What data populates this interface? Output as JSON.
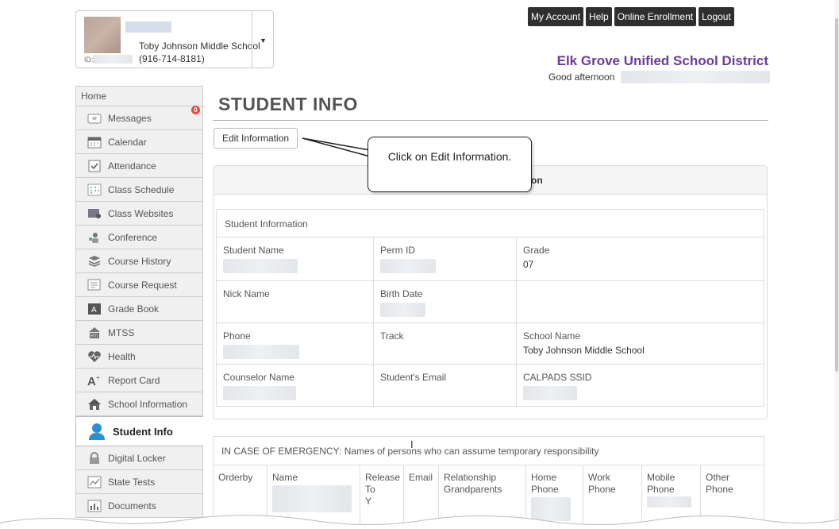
{
  "student": {
    "school": "Toby Johnson Middle School",
    "id_label": "ID:",
    "phone": "(916-714-8181)"
  },
  "topnav": [
    {
      "label": "My Account"
    },
    {
      "label": "Help"
    },
    {
      "label": "Online Enrollment"
    },
    {
      "label": "Logout"
    }
  ],
  "header": {
    "district": "Elk Grove Unified School District",
    "greeting": "Good afternoon"
  },
  "sidebar": {
    "home": "Home",
    "items": [
      {
        "label": "Messages",
        "icon": "messages-icon",
        "badge": "0"
      },
      {
        "label": "Calendar",
        "icon": "calendar-icon"
      },
      {
        "label": "Attendance",
        "icon": "attendance-icon"
      },
      {
        "label": "Class Schedule",
        "icon": "class-schedule-icon"
      },
      {
        "label": "Class Websites",
        "icon": "class-websites-icon"
      },
      {
        "label": "Conference",
        "icon": "conference-icon"
      },
      {
        "label": "Course History",
        "icon": "course-history-icon"
      },
      {
        "label": "Course Request",
        "icon": "course-request-icon"
      },
      {
        "label": "Grade Book",
        "icon": "grade-book-icon"
      },
      {
        "label": "MTSS",
        "icon": "mtss-icon"
      },
      {
        "label": "Health",
        "icon": "health-icon"
      },
      {
        "label": "Report Card",
        "icon": "report-card-icon"
      },
      {
        "label": "School Information",
        "icon": "school-information-icon"
      },
      {
        "label": "Student Info",
        "icon": "student-info-icon",
        "active": true
      },
      {
        "label": "Digital Locker",
        "icon": "digital-locker-icon"
      },
      {
        "label": "State Tests",
        "icon": "state-tests-icon"
      },
      {
        "label": "Documents",
        "icon": "documents-icon"
      }
    ]
  },
  "main": {
    "title": "STUDENT INFO",
    "edit_button": "Edit Information",
    "panel_heading_fragment": "on",
    "info": {
      "heading": "Student Information",
      "rows": [
        [
          {
            "label": "Student Name"
          },
          {
            "label": "Perm ID"
          },
          {
            "label": "Grade",
            "value": "07"
          }
        ],
        [
          {
            "label": "Nick Name"
          },
          {
            "label": "Birth Date"
          },
          {
            "label": ""
          }
        ],
        [
          {
            "label": "Phone"
          },
          {
            "label": "Track"
          },
          {
            "label": "School Name",
            "value": "Toby Johnson Middle School"
          }
        ],
        [
          {
            "label": "Counselor Name"
          },
          {
            "label": "Student's Email"
          },
          {
            "label": "CALPADS SSID"
          }
        ]
      ]
    },
    "emergency": {
      "heading": "IN CASE OF EMERGENCY: Names of persons who can assume temporary responsibility",
      "columns": [
        "Orderby",
        "Name",
        "Release To",
        "Email",
        "Relationship",
        "Home Phone",
        "Work Phone",
        "Mobile Phone",
        "Other Phone"
      ],
      "row": {
        "release_to": "Y",
        "relationship": "Grandparents"
      }
    }
  },
  "callout": {
    "text": "Click on Edit Information."
  },
  "colors": {
    "district": "#6a3c9b",
    "nav_button": "#2f2f2f",
    "badge": "#e74c3c"
  }
}
